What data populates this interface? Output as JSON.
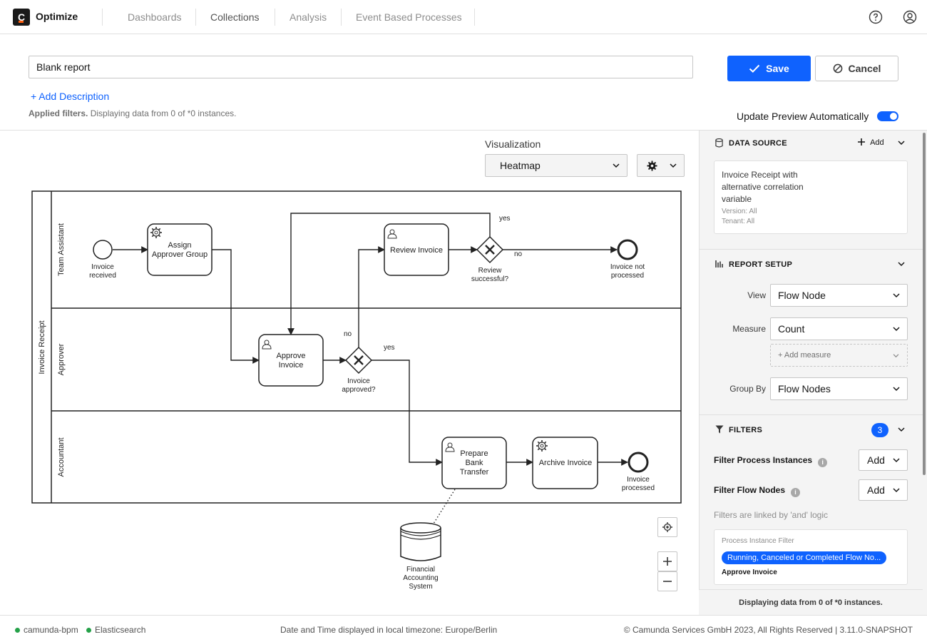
{
  "app": {
    "logo_letter": "C",
    "brand": "Optimize",
    "nav": [
      {
        "label": "Dashboards"
      },
      {
        "label": "Collections"
      },
      {
        "label": "Analysis"
      },
      {
        "label": "Event Based Processes"
      }
    ]
  },
  "report": {
    "name": "Blank report",
    "add_description": "+ Add Description",
    "applied_bold": "Applied filters.",
    "applied_text": "Displaying data from 0 of *0 instances.",
    "save_label": "Save",
    "cancel_label": "Cancel",
    "auto_preview_label": "Update Preview Automatically",
    "auto_preview_on": true
  },
  "visualization": {
    "label": "Visualization",
    "selected": "Heatmap"
  },
  "diagram": {
    "pool": "Invoice Receipt",
    "lanes": [
      "Team Assistant",
      "Approver",
      "Accountant"
    ],
    "tasks": {
      "assign": [
        "Assign",
        "Approver Group"
      ],
      "review": [
        "Review Invoice"
      ],
      "approve": [
        "Approve",
        "Invoice"
      ],
      "prepare": [
        "Prepare",
        "Bank",
        "Transfer"
      ],
      "archive": [
        "Archive Invoice"
      ]
    },
    "events": {
      "start": [
        "Invoice",
        "received"
      ],
      "not_processed": [
        "Invoice not",
        "processed"
      ],
      "processed": [
        "Invoice",
        "processed"
      ]
    },
    "gateways": {
      "review": [
        "Review",
        "successful?"
      ],
      "approved": [
        "Invoice",
        "approved?"
      ]
    },
    "flow_labels": {
      "yes_top": "yes",
      "no_top": "no",
      "no_mid": "no",
      "yes_mid": "yes"
    },
    "datastore": [
      "Financial",
      "Accounting",
      "System"
    ]
  },
  "panel": {
    "data_source": {
      "title": "DATA SOURCE",
      "add_label": "Add",
      "process_name_lines": [
        "Invoice Receipt with",
        "alternative correlation",
        "variable"
      ],
      "version": "Version: All",
      "tenant": "Tenant: All"
    },
    "report_setup": {
      "title": "REPORT SETUP",
      "view_label": "View",
      "view_value": "Flow Node",
      "measure_label": "Measure",
      "measure_value": "Count",
      "add_measure": "+ Add measure",
      "groupby_label": "Group By",
      "groupby_value": "Flow Nodes"
    },
    "filters": {
      "title": "FILTERS",
      "count": "3",
      "process_instances_label": "Filter Process Instances",
      "flow_nodes_label": "Filter Flow Nodes",
      "add_label": "Add",
      "logic_note": "Filters are linked by 'and' logic",
      "card_type": "Process Instance Filter",
      "card_tag": "Running, Canceled or Completed Flow No...",
      "card_node": "Approve Invoice"
    },
    "footer_text": "Displaying data from 0 of *0 instances."
  },
  "footer": {
    "engine": "camunda-bpm",
    "db": "Elasticsearch",
    "timezone": "Date and Time displayed in local timezone: Europe/Berlin",
    "copyright": "© Camunda Services GmbH 2023, All Rights Reserved | 3.11.0-SNAPSHOT"
  },
  "colors": {
    "accent": "#0f62fe",
    "status_ok": "#24a148",
    "logo_bar": "#fc5d0d"
  }
}
